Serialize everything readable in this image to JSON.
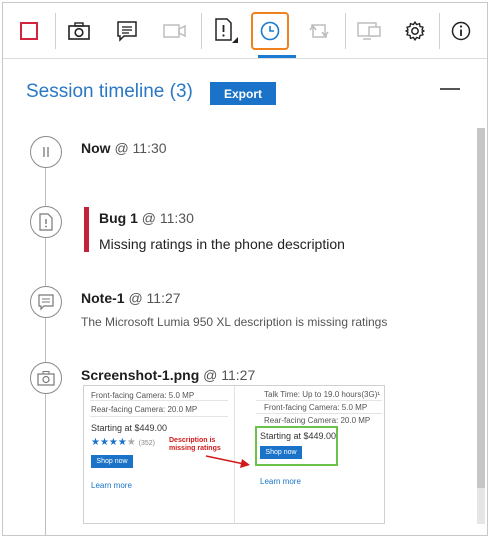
{
  "toolbar": {
    "buttons": [
      {
        "name": "stop-session",
        "icon": "stop-square-icon"
      },
      {
        "name": "capture-screenshot",
        "icon": "camera-icon"
      },
      {
        "name": "capture-note",
        "icon": "note-icon"
      },
      {
        "name": "record-video",
        "icon": "video-camera-icon"
      },
      {
        "name": "create-bug",
        "icon": "bug-document-icon"
      },
      {
        "name": "session-timeline",
        "icon": "clock-icon"
      },
      {
        "name": "repeat",
        "icon": "loop-icon"
      },
      {
        "name": "screen",
        "icon": "monitor-icon"
      },
      {
        "name": "settings",
        "icon": "gear-icon"
      },
      {
        "name": "info",
        "icon": "info-icon"
      }
    ],
    "accent_color": "#f0821e",
    "stop_color": "#d4233a"
  },
  "panel": {
    "title": "Session timeline (3)",
    "export_label": "Export",
    "title_color": "#2a78c5"
  },
  "timeline": {
    "now": {
      "label": "Now",
      "at": "@ 11:30"
    },
    "bug": {
      "label": "Bug 1",
      "at": "@ 11:30",
      "description": "Missing ratings in the phone description",
      "color": "#c4223a"
    },
    "note": {
      "label": "Note-1",
      "at": "@ 11:27",
      "description": "The Microsoft Lumia 950 XL description is missing ratings"
    },
    "screenshot": {
      "label": "Screenshot-1.png",
      "at": "@ 11:27",
      "thumb": {
        "left_col": {
          "line1": "Front-facing Camera: 5.0 MP",
          "line2": "Rear-facing Camera: 20.0 MP",
          "price": "Starting at $449.00",
          "stars": "★★★★",
          "star_grey": "★",
          "rating_count": "(352)",
          "shop": "Shop now",
          "learn": "Learn more"
        },
        "annotation": "Description is missing ratings",
        "right_col": {
          "line1": "Talk Time: Up to 19.0 hours(3G)¹",
          "line2": "Front-facing Camera: 5.0 MP",
          "line3": "Rear-facing Camera: 20.0 MP",
          "price": "Starting at $449.00",
          "shop": "Shop now",
          "learn": "Learn more"
        }
      }
    }
  }
}
